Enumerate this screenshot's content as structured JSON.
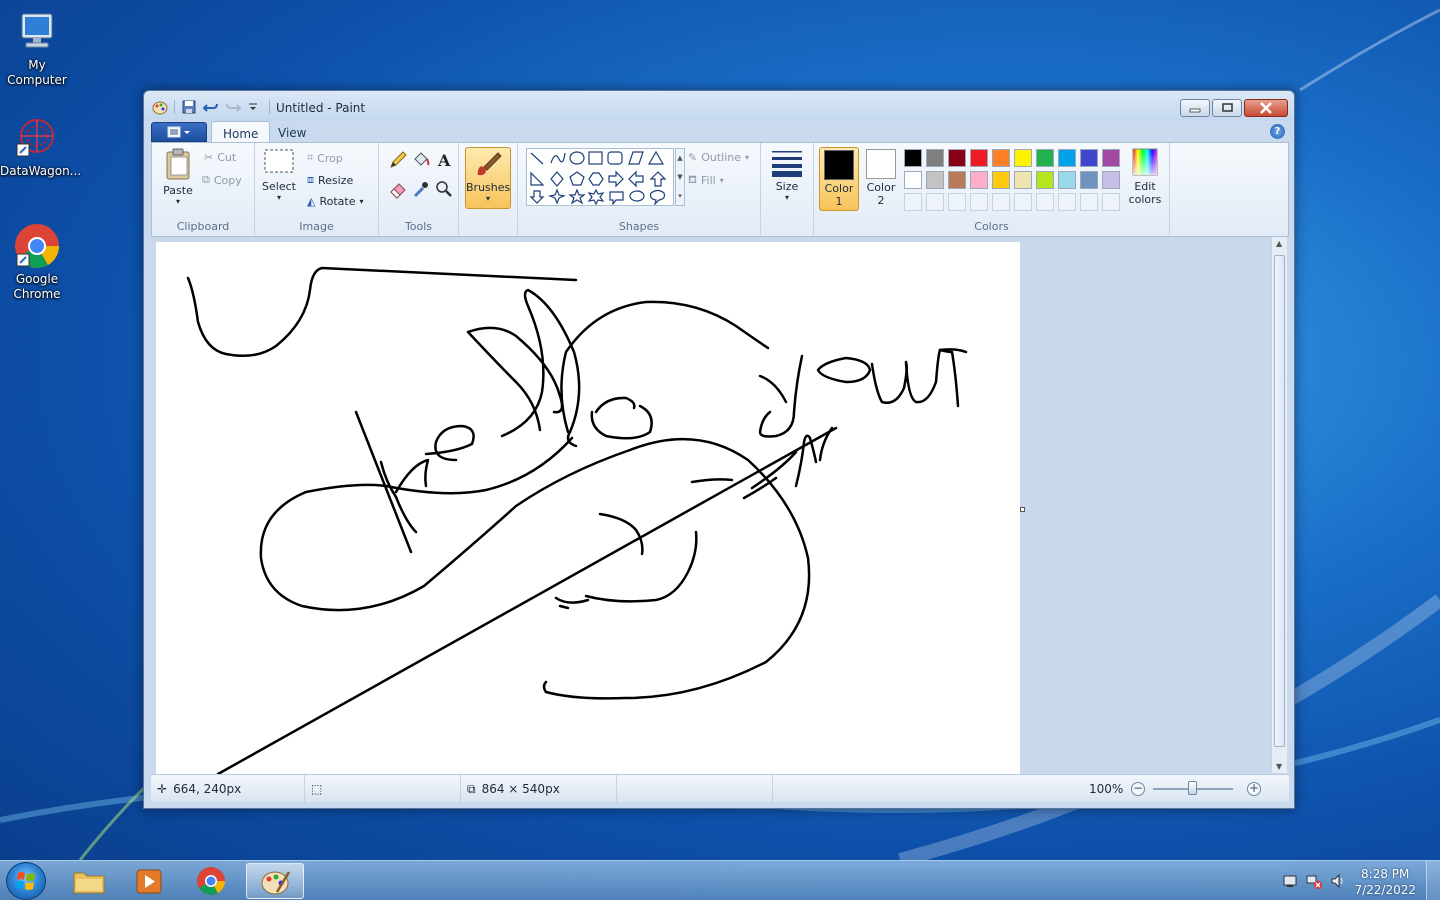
{
  "desktop": {
    "icons": [
      {
        "label": "My\nComputer",
        "icon": "computer-icon"
      },
      {
        "label": "DataWagon...",
        "icon": "datawagon-icon"
      },
      {
        "label": "Google\nChrome",
        "icon": "chrome-icon"
      }
    ]
  },
  "window": {
    "title": "Untitled - Paint",
    "tabs": [
      {
        "label": "Home",
        "active": true
      },
      {
        "label": "View",
        "active": false
      }
    ],
    "help_label": "?"
  },
  "ribbon": {
    "clipboard": {
      "label": "Clipboard",
      "paste": "Paste",
      "cut": "Cut",
      "copy": "Copy"
    },
    "image": {
      "label": "Image",
      "select": "Select",
      "crop": "Crop",
      "resize": "Resize",
      "rotate": "Rotate"
    },
    "tools": {
      "label": "Tools"
    },
    "brushes": {
      "label": "Brushes"
    },
    "shapes": {
      "label": "Shapes",
      "outline": "Outline",
      "fill": "Fill"
    },
    "size": {
      "label": "Size"
    },
    "colors": {
      "label": "Colors",
      "color1_label": "Color",
      "color1_num": "1",
      "color2_label": "Color",
      "color2_num": "2",
      "color1": "#000000",
      "color2": "#ffffff",
      "edit_label1": "Edit",
      "edit_label2": "colors",
      "palette_row1": [
        "#000000",
        "#7f7f7f",
        "#880015",
        "#ed1c24",
        "#ff7f27",
        "#fff200",
        "#22b14c",
        "#00a2e8",
        "#3f48cc",
        "#a349a4"
      ],
      "palette_row2": [
        "#ffffff",
        "#c3c3c3",
        "#b97a57",
        "#ffaec9",
        "#ffc90e",
        "#efe4b0",
        "#b5e61d",
        "#99d9ea",
        "#7092be",
        "#c8bfe7"
      ]
    }
  },
  "statusbar": {
    "cursor_pos": "664, 240px",
    "selection_size": "",
    "canvas_size": "864 × 540px",
    "zoom": "100%"
  },
  "taskbar": {
    "time": "8:28 PM",
    "date": "7/22/2022"
  }
}
